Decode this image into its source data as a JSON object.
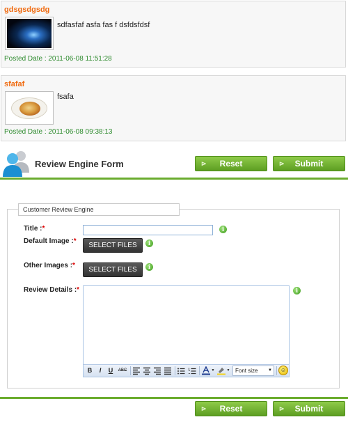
{
  "posts": [
    {
      "title": "gdsgsdgsdg",
      "body": "sdfasfaf asfa fas f  dsfdsfdsf",
      "date": "Posted Date : 2011-06-08 11:51:28",
      "image": "space-photo"
    },
    {
      "title": "sfafaf",
      "body": "fsafa",
      "date": "Posted Date : 2011-06-08 09:38:13",
      "image": "pasta-plate-photo"
    }
  ],
  "form_header": {
    "title": "Review Engine Form",
    "icon": "users-icon"
  },
  "buttons": {
    "reset": "Reset",
    "submit": "Submit",
    "arrow": "⊳"
  },
  "fieldset": {
    "legend": "Customer Review Engine"
  },
  "fields": {
    "title": {
      "label": "Title :",
      "req": "*",
      "value": ""
    },
    "default_image": {
      "label": "Default Image :",
      "req": "*",
      "button": "SELECT FILES"
    },
    "other_images": {
      "label": "Other Images :",
      "req": "*",
      "button": "SELECT FILES"
    },
    "review_details": {
      "label": "Review Details :",
      "req": "*",
      "value": ""
    }
  },
  "info_glyph": "i",
  "editor_toolbar": {
    "bold": "B",
    "italic": "I",
    "underline": "U",
    "strike": "ABC",
    "font_size": "Font size",
    "dropdown": "▼",
    "smiley": "☺"
  },
  "colors": {
    "accent_green": "#6aac2d",
    "post_title": "#f06a0f",
    "post_date": "#2e8b2e",
    "required": "#dd0000"
  }
}
